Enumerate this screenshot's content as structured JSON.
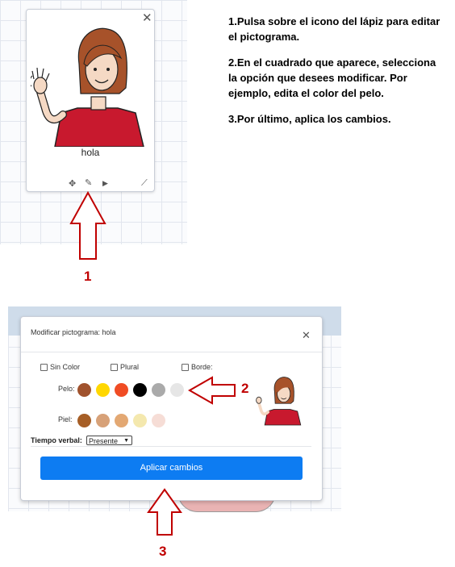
{
  "card": {
    "close_label": "✕",
    "label": "hola",
    "tools": {
      "move": "✥",
      "edit": "✎",
      "play": "▶",
      "resize": "⟋"
    }
  },
  "instructions": [
    "1.Pulsa sobre el icono del lápiz para editar el pictograma.",
    "2.En el cuadrado que aparece, selecciona la opción que desees modificar. Por ejemplo, edita el color del pelo.",
    "3.Por último, aplica los cambios."
  ],
  "callouts": {
    "one": "1",
    "two": "2",
    "three": "3"
  },
  "modal": {
    "title": "Modificar pictograma: hola",
    "close_label": "✕",
    "options": {
      "sin_color": "Sin Color",
      "plural": "Plural",
      "borde": "Borde:"
    },
    "pelo_label": "Pelo:",
    "piel_label": "Piel:",
    "hair_colors": [
      "#A0522D",
      "#FFD700",
      "#F04C24",
      "#000000",
      "#AAAAAA",
      "#E6E6E6"
    ],
    "skin_colors": [
      "#A65E26",
      "#D7A178",
      "#E3A873",
      "#F4E8AE",
      "#F6DDD6"
    ],
    "verbal_label": "Tiempo verbal:",
    "verbal_value": "Presente",
    "apply_label": "Aplicar cambios"
  },
  "colors": {
    "accent": "#0d7cf2",
    "callout": "#c00000"
  }
}
